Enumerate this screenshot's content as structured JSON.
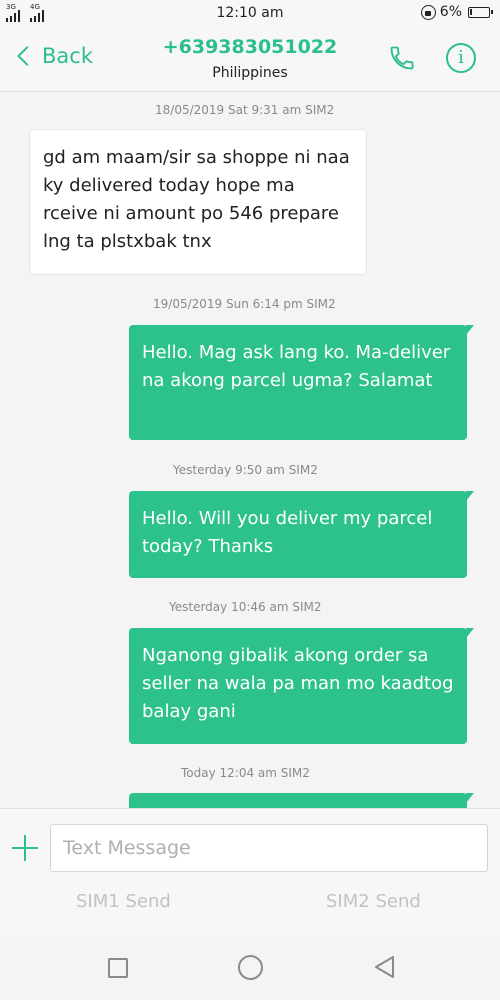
{
  "status_bar": {
    "signal1_label": "3G",
    "signal2_label": "4G",
    "time": "12:10 am",
    "battery": "6%"
  },
  "header": {
    "back_label": "Back",
    "contact_number": "+639383051022",
    "contact_country": "Philippines"
  },
  "messages": [
    {
      "timestamp": "18/05/2019 Sat 9:31 am  SIM2",
      "direction": "incoming",
      "text": "gd am maam/sir sa shoppe ni naa ky delivered today hope ma rceive ni amount po 546 prepare lng ta plstxbak tnx"
    },
    {
      "timestamp": "19/05/2019 Sun 6:14 pm  SIM2",
      "direction": "outgoing",
      "text": "Hello. Mag ask lang ko. Ma-deliver na akong parcel ugma? Salamat"
    },
    {
      "timestamp": "Yesterday 9:50 am  SIM2",
      "direction": "outgoing",
      "text": "Hello. Will you deliver my  parcel today? Thanks"
    },
    {
      "timestamp": "Yesterday 10:46 am  SIM2",
      "direction": "outgoing",
      "text": "Nganong gibalik akong order sa seller na wala pa man mo kaadtog balay gani"
    },
    {
      "timestamp": "Today 12:04 am  SIM2",
      "direction": "outgoing",
      "text": ""
    }
  ],
  "compose": {
    "placeholder": "Text Message",
    "sim1_send": "SIM1 Send",
    "sim2_send": "SIM2 Send"
  },
  "colors": {
    "accent": "#2bbf8a",
    "outgoing_bubble": "#2dc28c",
    "incoming_bubble": "#ffffff"
  }
}
